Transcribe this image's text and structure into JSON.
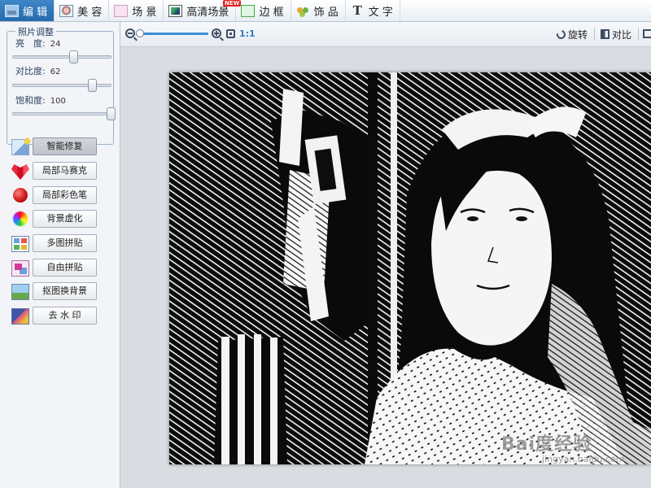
{
  "tabs": [
    {
      "label": "编 辑",
      "icon": "edit-icon",
      "active": true
    },
    {
      "label": "美 容",
      "icon": "beauty-icon",
      "active": false
    },
    {
      "label": "场 景",
      "icon": "scene-icon",
      "active": false
    },
    {
      "label": "高清场景",
      "icon": "hd-scene-icon",
      "active": false,
      "badge": "NEW"
    },
    {
      "label": "边 框",
      "icon": "frame-icon",
      "active": false
    },
    {
      "label": "饰 品",
      "icon": "decoration-icon",
      "active": false
    },
    {
      "label": "文 字",
      "icon": "text-icon",
      "active": false
    }
  ],
  "adjust": {
    "title": "照片调整",
    "brightness": {
      "label": "亮　度:",
      "value": "24",
      "fraction": 0.62
    },
    "contrast": {
      "label": "对比度:",
      "value": "62",
      "fraction": 0.81
    },
    "saturation": {
      "label": "饱和度:",
      "value": "100",
      "fraction": 1.0
    }
  },
  "tools": [
    {
      "label": "智能修复",
      "icon": "smart-repair-icon",
      "selected": true
    },
    {
      "label": "局部马赛克",
      "icon": "mosaic-icon",
      "selected": false
    },
    {
      "label": "局部彩色笔",
      "icon": "color-pen-icon",
      "selected": false
    },
    {
      "label": "背景虚化",
      "icon": "background-blur-icon",
      "selected": false
    },
    {
      "label": "多图拼贴",
      "icon": "multi-collage-icon",
      "selected": false
    },
    {
      "label": "自由拼贴",
      "icon": "free-collage-icon",
      "selected": false
    },
    {
      "label": "抠图换背景",
      "icon": "cutout-icon",
      "selected": false
    },
    {
      "label": "去 水 印",
      "icon": "watermark-remove-icon",
      "selected": false
    }
  ],
  "view_toolbar": {
    "zoom_fraction": 0.0,
    "one_to_one": "1:1",
    "rotate": "旋转",
    "compare": "对比"
  },
  "watermark": {
    "main": "Bai度经验",
    "sub": "jingyan.baidu.com"
  },
  "colors": {
    "accent": "#2d7cc6",
    "active_tab": "#2f75b8"
  }
}
